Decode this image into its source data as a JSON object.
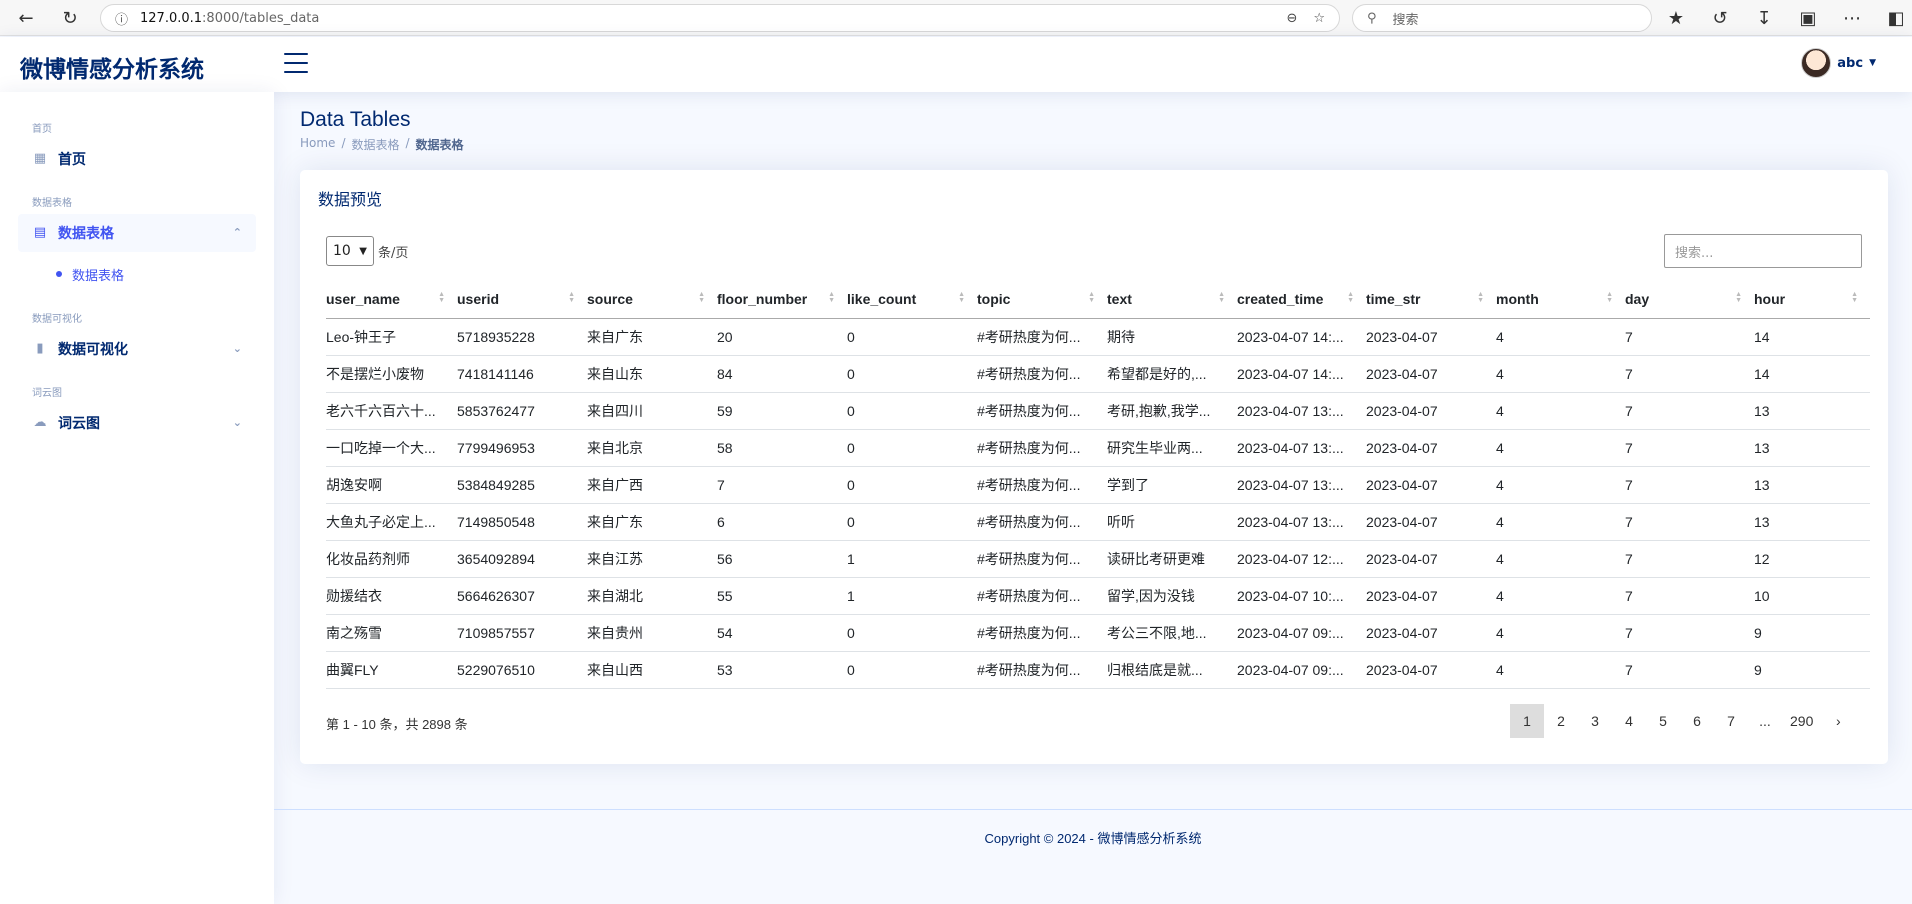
{
  "browser": {
    "url_host": "127.0.0.1",
    "url_path": ":8000/tables_data",
    "search_placeholder": "搜索"
  },
  "header": {
    "logo": "微博情感分析系统",
    "user_name": "abc"
  },
  "sidebar": {
    "sections": [
      {
        "heading": "首页",
        "label": "首页",
        "icon": "grid-icon"
      },
      {
        "heading": "数据表格",
        "label": "数据表格",
        "icon": "table-icon",
        "sub": "数据表格"
      },
      {
        "heading": "数据可视化",
        "label": "数据可视化",
        "icon": "bar-chart-icon"
      },
      {
        "heading": "词云图",
        "label": "词云图",
        "icon": "cloud-icon"
      }
    ]
  },
  "page": {
    "title": "Data Tables",
    "breadcrumb": [
      "Home",
      "数据表格",
      "数据表格"
    ]
  },
  "card": {
    "title": "数据预览",
    "per_page_value": "10",
    "per_page_suffix": "条/页",
    "search_placeholder": "搜索..."
  },
  "table": {
    "columns": [
      "user_name",
      "userid",
      "source",
      "floor_number",
      "like_count",
      "topic",
      "text",
      "created_time",
      "time_str",
      "month",
      "day",
      "hour"
    ],
    "rows": [
      [
        "Leo-钟王子",
        "5718935228",
        "来自广东",
        "20",
        "0",
        "#考研热度为何...",
        "期待",
        "2023-04-07 14:...",
        "2023-04-07",
        "4",
        "7",
        "14"
      ],
      [
        "不是摆烂小废物",
        "7418141146",
        "来自山东",
        "84",
        "0",
        "#考研热度为何...",
        "希望都是好的,...",
        "2023-04-07 14:...",
        "2023-04-07",
        "4",
        "7",
        "14"
      ],
      [
        "老六千六百六十...",
        "5853762477",
        "来自四川",
        "59",
        "0",
        "#考研热度为何...",
        "考研,抱歉,我学...",
        "2023-04-07 13:...",
        "2023-04-07",
        "4",
        "7",
        "13"
      ],
      [
        "一口吃掉一个大...",
        "7799496953",
        "来自北京",
        "58",
        "0",
        "#考研热度为何...",
        "研究生毕业两...",
        "2023-04-07 13:...",
        "2023-04-07",
        "4",
        "7",
        "13"
      ],
      [
        "胡逸安啊",
        "5384849285",
        "来自广西",
        "7",
        "0",
        "#考研热度为何...",
        "学到了",
        "2023-04-07 13:...",
        "2023-04-07",
        "4",
        "7",
        "13"
      ],
      [
        "大鱼丸子必定上...",
        "7149850548",
        "来自广东",
        "6",
        "0",
        "#考研热度为何...",
        "听听",
        "2023-04-07 13:...",
        "2023-04-07",
        "4",
        "7",
        "13"
      ],
      [
        "化妆品药剂师",
        "3654092894",
        "来自江苏",
        "56",
        "1",
        "#考研热度为何...",
        "读研比考研更难",
        "2023-04-07 12:...",
        "2023-04-07",
        "4",
        "7",
        "12"
      ],
      [
        "勋援结衣",
        "5664626307",
        "来自湖北",
        "55",
        "1",
        "#考研热度为何...",
        "留学,因为没钱",
        "2023-04-07 10:...",
        "2023-04-07",
        "4",
        "7",
        "10"
      ],
      [
        "南之殇雪",
        "7109857557",
        "来自贵州",
        "54",
        "0",
        "#考研热度为何...",
        "考公三不限,地...",
        "2023-04-07 09:...",
        "2023-04-07",
        "4",
        "7",
        "9"
      ],
      [
        "曲翼FLY",
        "5229076510",
        "来自山西",
        "53",
        "0",
        "#考研热度为何...",
        "归根结底是就...",
        "2023-04-07 09:...",
        "2023-04-07",
        "4",
        "7",
        "9"
      ]
    ]
  },
  "pagination": {
    "info": "第 1 - 10 条，共 2898 条",
    "pages": [
      "1",
      "2",
      "3",
      "4",
      "5",
      "6",
      "7",
      "...",
      "290",
      "›"
    ],
    "current": "1"
  },
  "footer": {
    "text": "Copyright © 2024 - 微博情感分析系统"
  }
}
